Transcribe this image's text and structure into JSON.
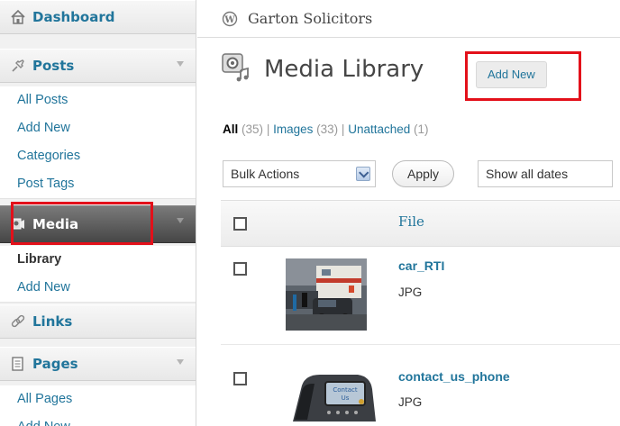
{
  "sidebar": {
    "dashboard": {
      "label": "Dashboard",
      "icon": "dashboard-house-icon"
    },
    "posts": {
      "label": "Posts",
      "icon": "pushpin-icon",
      "items": [
        {
          "label": "All Posts"
        },
        {
          "label": "Add New"
        },
        {
          "label": "Categories"
        },
        {
          "label": "Post Tags"
        }
      ]
    },
    "media": {
      "label": "Media",
      "icon": "media-icon",
      "items": [
        {
          "label": "Library",
          "current": true
        },
        {
          "label": "Add New"
        }
      ]
    },
    "links": {
      "label": "Links",
      "icon": "chain-link-icon"
    },
    "pages": {
      "label": "Pages",
      "icon": "pages-icon",
      "items": [
        {
          "label": "All Pages"
        },
        {
          "label": "Add New"
        }
      ]
    }
  },
  "header": {
    "site_name": "Garton Solicitors",
    "site_icon": "wordpress-logo-icon"
  },
  "page": {
    "title": "Media Library",
    "add_new_label": "Add New"
  },
  "filters": {
    "all": {
      "label": "All",
      "count": "(35)"
    },
    "images": {
      "label": "Images",
      "count": "(33)"
    },
    "unattached": {
      "label": "Unattached",
      "count": "(1)"
    },
    "separator": "|"
  },
  "toolbar": {
    "bulk_actions": "Bulk Actions",
    "apply": "Apply",
    "dates": "Show all dates"
  },
  "table": {
    "column_file": "File",
    "rows": [
      {
        "title": "car_RTI",
        "type": "JPG",
        "thumb_icon": "ambulance-crash-thumbnail"
      },
      {
        "title": "contact_us_phone",
        "type": "JPG",
        "thumb_icon": "office-phone-thumbnail"
      }
    ]
  },
  "colors": {
    "link": "#21759b",
    "highlight": "#e3101a",
    "active_menu": "#464646"
  }
}
